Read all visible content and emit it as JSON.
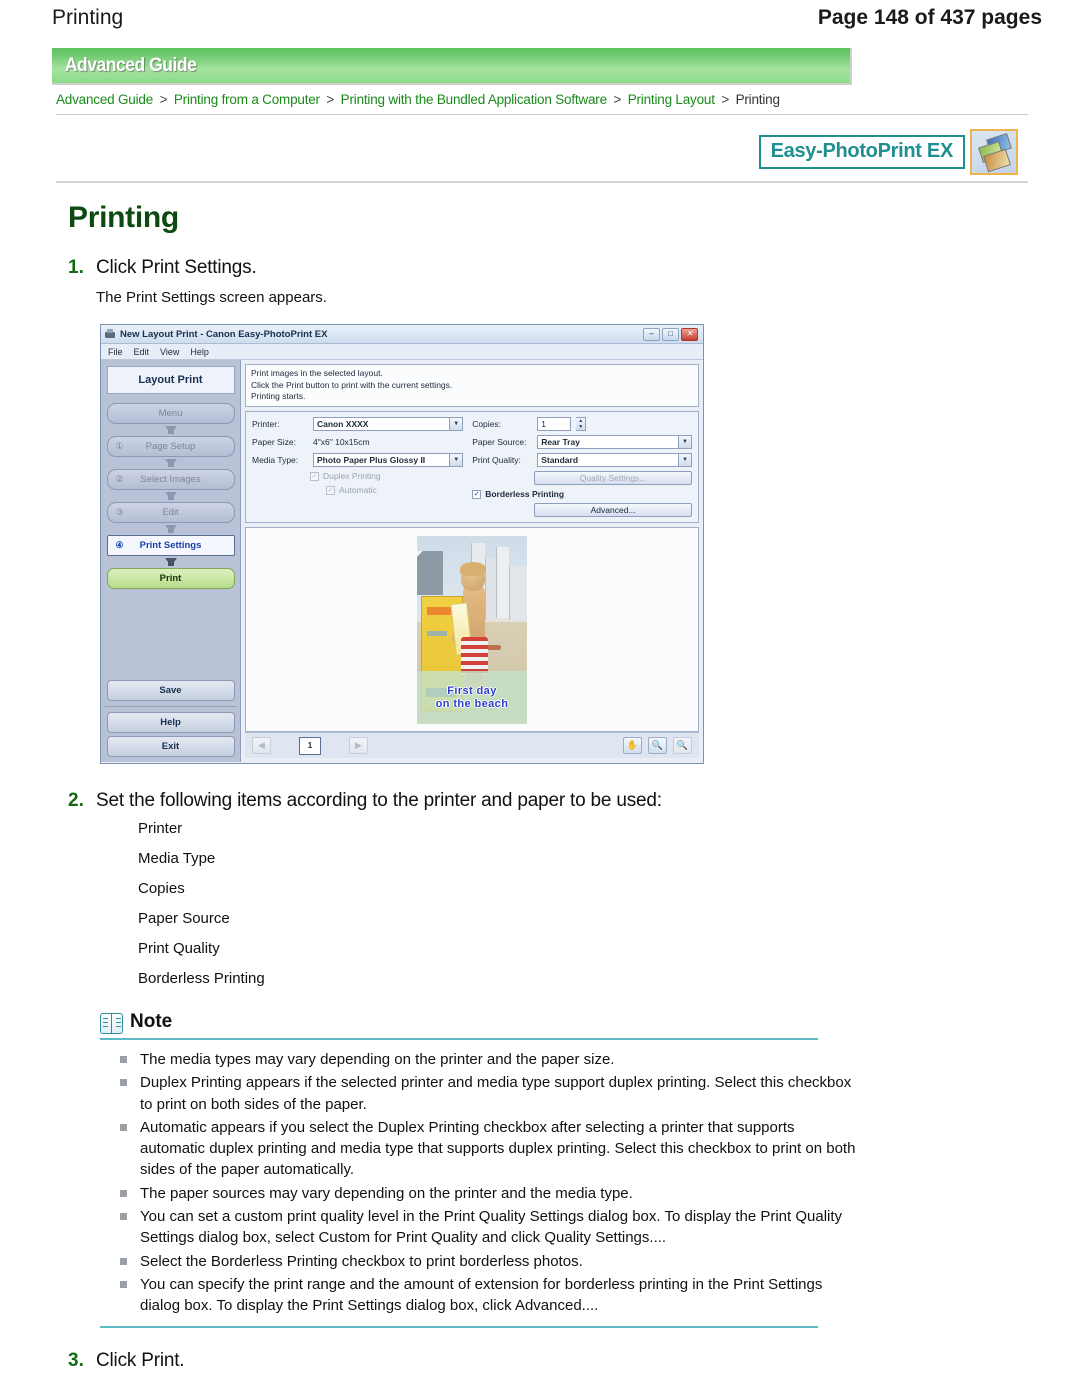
{
  "page_header": {
    "left": "Printing",
    "right": "Page 148 of 437 pages"
  },
  "banner": {
    "title": "Advanced Guide"
  },
  "breadcrumb": {
    "items": [
      "Advanced Guide",
      "Printing from a Computer",
      "Printing with the Bundled Application Software",
      "Printing Layout",
      "Printing"
    ],
    "separator": ">"
  },
  "logo": {
    "text": "Easy-PhotoPrint EX",
    "icon": "photo-stack-icon"
  },
  "doc": {
    "title": "Printing",
    "step1": {
      "num": "1.",
      "text": "Click Print Settings.",
      "sub": "The Print Settings screen appears."
    },
    "step2": {
      "num": "2.",
      "text": "Set the following items according to the printer and paper to be used:",
      "items": [
        "Printer",
        "Media Type",
        "Copies",
        "Paper Source",
        "Print Quality",
        "Borderless Printing"
      ]
    },
    "step3": {
      "num": "3.",
      "text": "Click Print."
    }
  },
  "screenshot": {
    "titlebar": {
      "title": "New Layout Print - Canon Easy-PhotoPrint EX",
      "minimize": "–",
      "maximize": "□",
      "close": "✕"
    },
    "menus": [
      "File",
      "Edit",
      "View",
      "Help"
    ],
    "sidebar": {
      "mode": "Layout Print",
      "buttons": [
        {
          "num": "",
          "label": "Menu",
          "state": "normal"
        },
        {
          "num": "①",
          "label": "Page Setup",
          "state": "normal"
        },
        {
          "num": "②",
          "label": "Select Images",
          "state": "normal"
        },
        {
          "num": "③",
          "label": "Edit",
          "state": "normal"
        },
        {
          "num": "④",
          "label": "Print Settings",
          "state": "active"
        },
        {
          "num": "",
          "label": "Print",
          "state": "print"
        }
      ],
      "footer_buttons": [
        "Save",
        "Help",
        "Exit"
      ]
    },
    "description": [
      "Print images in the selected layout.",
      "Click the Print button to print with the current settings.",
      "Printing starts."
    ],
    "settings": {
      "printer_label": "Printer:",
      "printer_value": "Canon XXXX",
      "paper_size_label": "Paper Size:",
      "paper_size_value": "4\"x6\" 10x15cm",
      "media_type_label": "Media Type:",
      "media_type_value": "Photo Paper Plus Glossy II",
      "duplex_label": "Duplex Printing",
      "automatic_label": "Automatic",
      "copies_label": "Copies:",
      "copies_value": "1",
      "paper_source_label": "Paper Source:",
      "paper_source_value": "Rear Tray",
      "print_quality_label": "Print Quality:",
      "print_quality_value": "Standard",
      "quality_settings_button": "Quality Settings...",
      "borderless_label": "Borderless Printing",
      "advanced_button": "Advanced...",
      "checkmark": "✓"
    },
    "preview": {
      "caption_line1": "First day",
      "caption_line2": "on the beach"
    },
    "toolbar": {
      "prev": "◀",
      "page": "1",
      "next": "▶",
      "hand": "✋",
      "zoom_in": "🔍",
      "zoom_out": "🔍"
    }
  },
  "note": {
    "title": "Note",
    "icon": "book-icon",
    "items": [
      "The media types may vary depending on the printer and the paper size.",
      "Duplex Printing appears if the selected printer and media type support duplex printing. Select this checkbox to print on both sides of the paper.",
      "Automatic appears if you select the Duplex Printing checkbox after selecting a printer that supports automatic duplex printing and media type that supports duplex printing. Select this checkbox to print on both sides of the paper automatically.",
      "The paper sources may vary depending on the printer and the media type.",
      "You can set a custom print quality level in the Print Quality Settings dialog box. To display the Print Quality Settings dialog box, select Custom for Print Quality and click Quality Settings....",
      "Select the Borderless Printing checkbox to print borderless photos.",
      "You can specify the print range and the amount of extension for borderless printing in the Print Settings dialog box. To display the Print Settings dialog box, click Advanced...."
    ]
  }
}
